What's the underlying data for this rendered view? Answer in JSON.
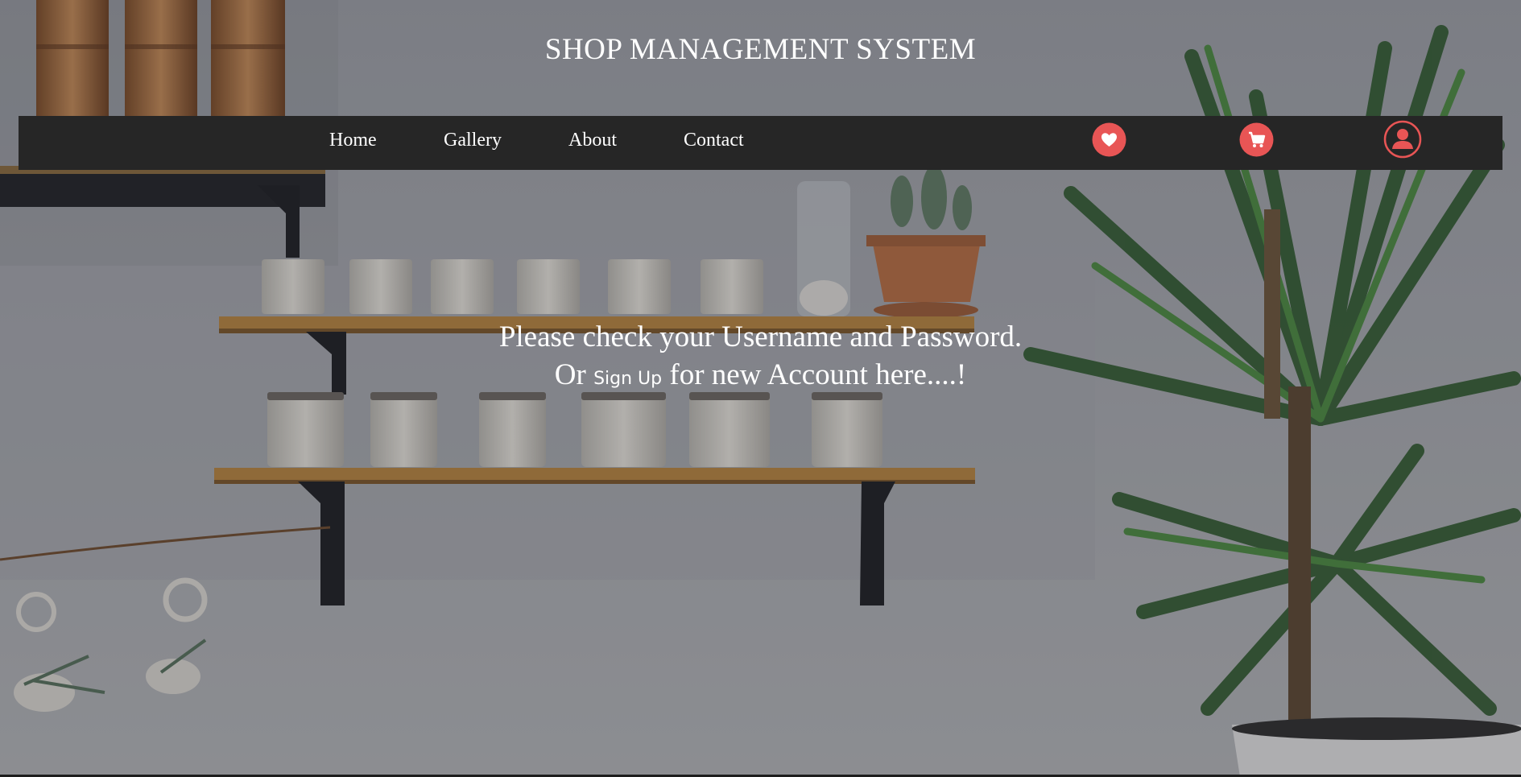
{
  "header": {
    "title": "SHOP MANAGEMENT SYSTEM"
  },
  "nav": {
    "links": [
      {
        "label": "Home"
      },
      {
        "label": "Gallery"
      },
      {
        "label": "About"
      },
      {
        "label": "Contact"
      }
    ],
    "icons": [
      {
        "name": "heart-icon"
      },
      {
        "name": "cart-icon"
      },
      {
        "name": "user-icon"
      }
    ]
  },
  "message": {
    "line1": "Please check your Username and Password.",
    "line2_prefix": "Or",
    "signup_label": "Sign Up",
    "line2_suffix": "for new Account here....!"
  },
  "colors": {
    "navbar_bg": "#262626",
    "icon_accent": "#e85555",
    "text": "#ffffff"
  }
}
